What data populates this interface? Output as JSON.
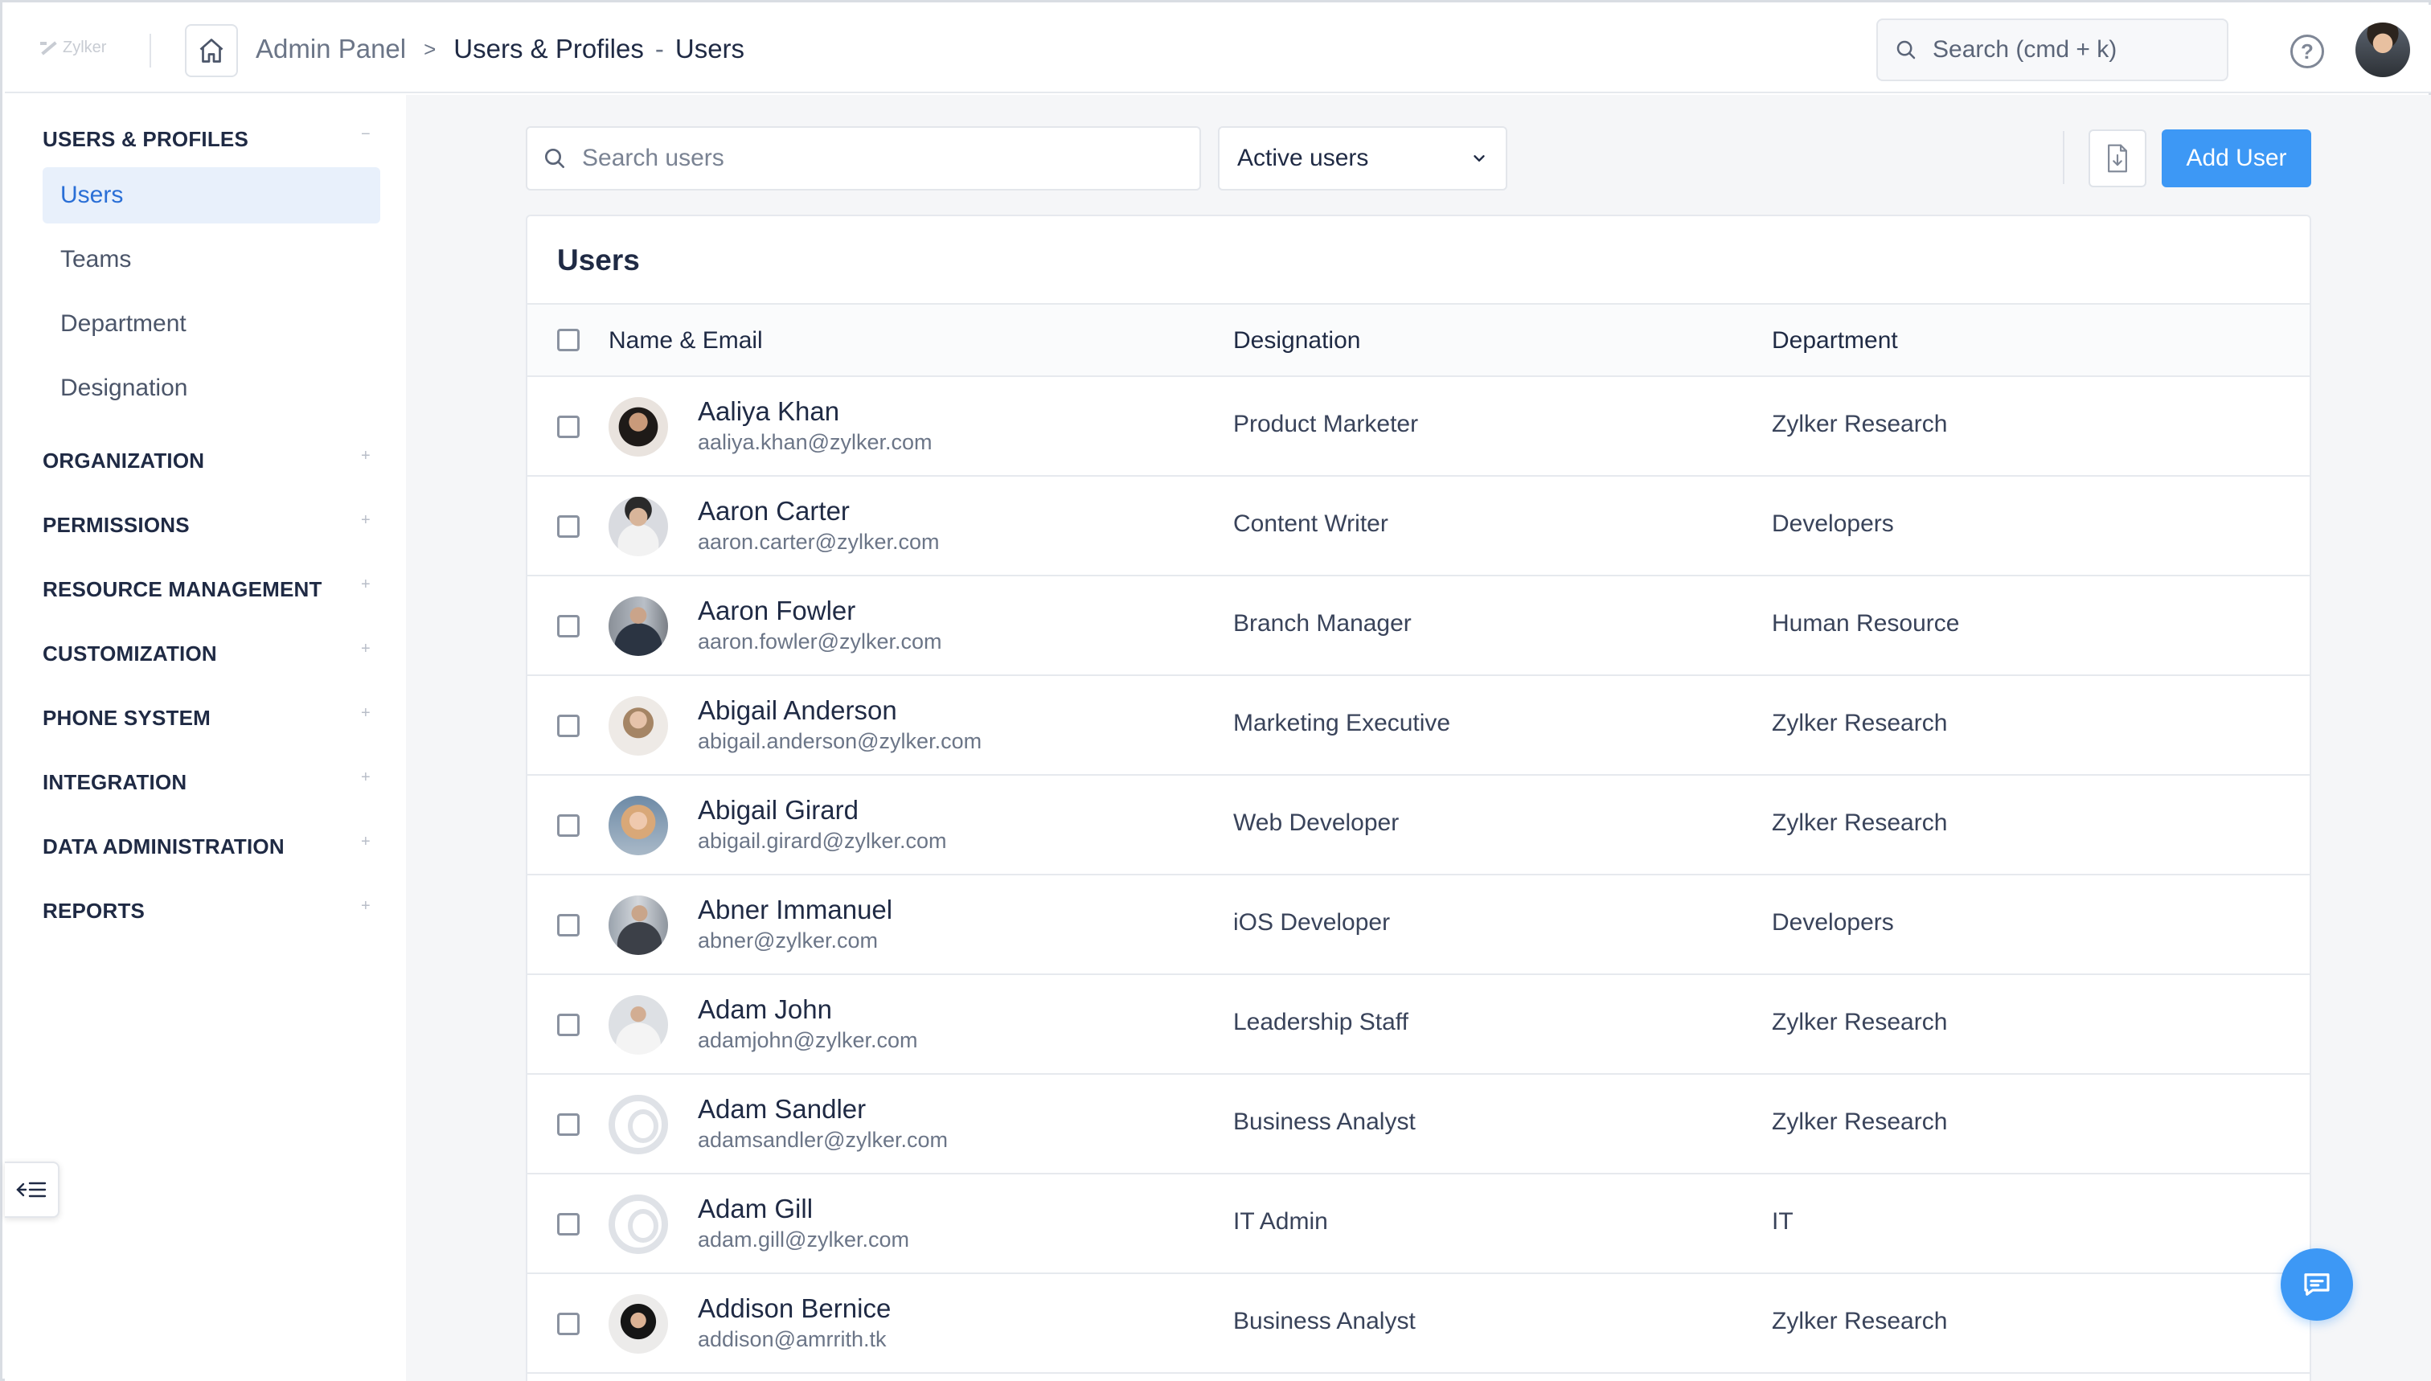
{
  "header": {
    "logo_text": "Zylker",
    "breadcrumb": {
      "root": "Admin Panel",
      "separator": ">",
      "section": "Users & Profiles",
      "dash": "-",
      "page": "Users"
    },
    "search_placeholder": "Search (cmd + k)",
    "help_label": "?"
  },
  "sidebar": {
    "sections": [
      {
        "label": "USERS & PROFILES",
        "toggle": "−",
        "items": [
          "Users",
          "Teams",
          "Department",
          "Designation"
        ],
        "active": "Users"
      },
      {
        "label": "ORGANIZATION",
        "toggle": "+"
      },
      {
        "label": "PERMISSIONS",
        "toggle": "+"
      },
      {
        "label": "RESOURCE MANAGEMENT",
        "toggle": "+"
      },
      {
        "label": "CUSTOMIZATION",
        "toggle": "+"
      },
      {
        "label": "PHONE SYSTEM",
        "toggle": "+"
      },
      {
        "label": "INTEGRATION",
        "toggle": "+"
      },
      {
        "label": "DATA ADMINISTRATION",
        "toggle": "+"
      },
      {
        "label": "REPORTS",
        "toggle": "+"
      }
    ]
  },
  "toolbar": {
    "search_placeholder": "Search users",
    "filter_value": "Active users",
    "add_user_label": "Add User"
  },
  "table": {
    "title": "Users",
    "columns": [
      "Name & Email",
      "Designation",
      "Department"
    ],
    "rows": [
      {
        "name": "Aaliya Khan",
        "email": "aaliya.khan@zylker.com",
        "designation": "Product Marketer",
        "department": "Zylker Research",
        "avatar": "photo"
      },
      {
        "name": "Aaron Carter",
        "email": "aaron.carter@zylker.com",
        "designation": "Content Writer",
        "department": "Developers",
        "avatar": "photo"
      },
      {
        "name": "Aaron Fowler",
        "email": "aaron.fowler@zylker.com",
        "designation": "Branch Manager",
        "department": "Human Resource",
        "avatar": "photo"
      },
      {
        "name": "Abigail Anderson",
        "email": "abigail.anderson@zylker.com",
        "designation": "Marketing Executive",
        "department": "Zylker Research",
        "avatar": "photo"
      },
      {
        "name": "Abigail Girard",
        "email": "abigail.girard@zylker.com",
        "designation": "Web Developer",
        "department": "Zylker Research",
        "avatar": "photo"
      },
      {
        "name": "Abner Immanuel",
        "email": "abner@zylker.com",
        "designation": "iOS Developer",
        "department": "Developers",
        "avatar": "photo"
      },
      {
        "name": "Adam John",
        "email": "adamjohn@zylker.com",
        "designation": "Leadership Staff",
        "department": "Zylker Research",
        "avatar": "photo"
      },
      {
        "name": "Adam Sandler",
        "email": "adamsandler@zylker.com",
        "designation": "Business Analyst",
        "department": "Zylker Research",
        "avatar": "placeholder"
      },
      {
        "name": "Adam Gill",
        "email": "adam.gill@zylker.com",
        "designation": "IT Admin",
        "department": "IT",
        "avatar": "placeholder"
      },
      {
        "name": "Addison Bernice",
        "email": "addison@amrrith.tk",
        "designation": "Business Analyst",
        "department": "Zylker Research",
        "avatar": "photo"
      }
    ]
  },
  "colors": {
    "accent": "#3d98f5",
    "active_nav_bg": "#e8f0fb",
    "active_nav_text": "#2a6fd6",
    "text_primary": "#1f2a44",
    "text_secondary": "#6b7587"
  }
}
